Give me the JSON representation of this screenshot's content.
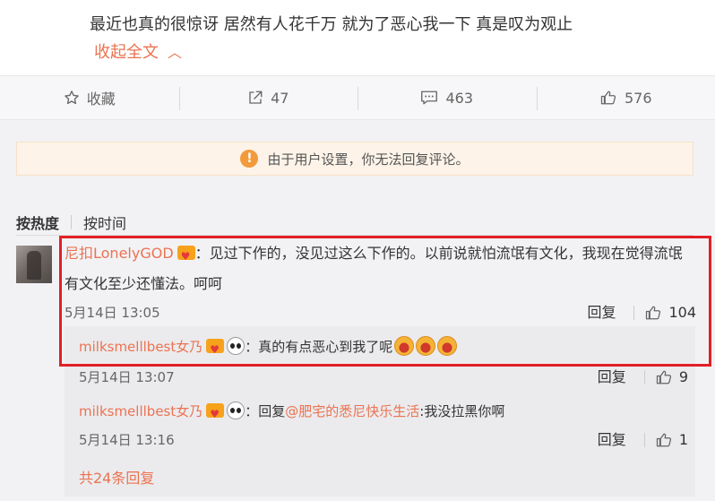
{
  "post": {
    "text": "最近也真的很惊讶 居然有人花千万 就为了恶心我一下 真是叹为观止",
    "collapse_label": "收起全文"
  },
  "toolbar": {
    "favorite_label": "收藏",
    "share_count": "47",
    "comment_count": "463",
    "like_count": "576"
  },
  "notice": {
    "text": "由于用户设置，你无法回复评论。"
  },
  "sort": {
    "hot": "按热度",
    "time": "按时间"
  },
  "comment": {
    "user": "尼扣LonelyGOD",
    "text_line1": "：见过下作的，没见过这么下作的。以前说就怕流氓有文化，我现在觉得流氓",
    "text_line2": "有文化至少还懂法。呵呵",
    "time": "5月14日 13:05",
    "reply_label": "回复",
    "likes": "104"
  },
  "replies": [
    {
      "user": "milksmelllbest女乃",
      "text": "：真的有点恶心到我了呢",
      "time": "5月14日 13:07",
      "reply_label": "回复",
      "likes": "9"
    },
    {
      "user": "milksmelllbest女乃",
      "prefix": "：回复",
      "mention": "@肥宅的悉尼快乐生活",
      "text": ":我没拉黑你啊",
      "time": "5月14日 13:16",
      "reply_label": "回复",
      "likes": "1"
    }
  ],
  "total_replies": "共24条回复",
  "colors": {
    "accent": "#eb7350",
    "highlight_border": "#e21f26"
  }
}
